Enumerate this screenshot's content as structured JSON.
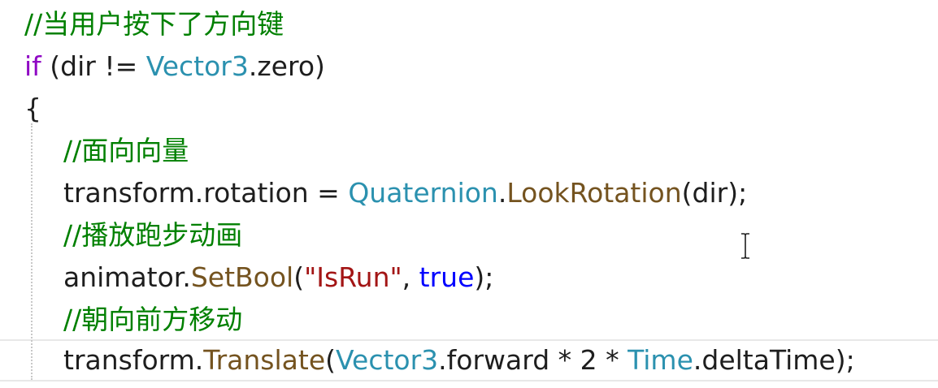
{
  "colors": {
    "comment": "#008000",
    "keyword": "#0000ff",
    "control_keyword": "#8f08c4",
    "type": "#2b91af",
    "method": "#74531f",
    "string": "#a31515",
    "plain": "#1e1e1e"
  },
  "code": {
    "line1": {
      "comment": "//当用户按下了方向键"
    },
    "line2": {
      "kw_if": "if",
      "open": " (dir != ",
      "type": "Vector3",
      "rest": ".zero)"
    },
    "line3": {
      "brace": "{"
    },
    "line4": {
      "comment": "//面向向量"
    },
    "line5": {
      "lhs": "transform.rotation = ",
      "type": "Quaternion",
      "dot": ".",
      "method": "LookRotation",
      "rest": "(dir);"
    },
    "line6": {
      "comment": "//播放跑步动画"
    },
    "line7": {
      "obj": "animator.",
      "method": "SetBool",
      "paren": "(",
      "string": "\"IsRun\"",
      "comma": ", ",
      "kw_true": "true",
      "rest": ");"
    },
    "line8": {
      "comment": "//朝向前方移动"
    },
    "line9": {
      "obj": "transform.",
      "method": "Translate",
      "paren": "(",
      "type1": "Vector3",
      "mid": ".forward * 2 * ",
      "type2": "Time",
      "rest": ".deltaTime);"
    }
  },
  "cursor_icon": "text-cursor-ibeam-icon"
}
